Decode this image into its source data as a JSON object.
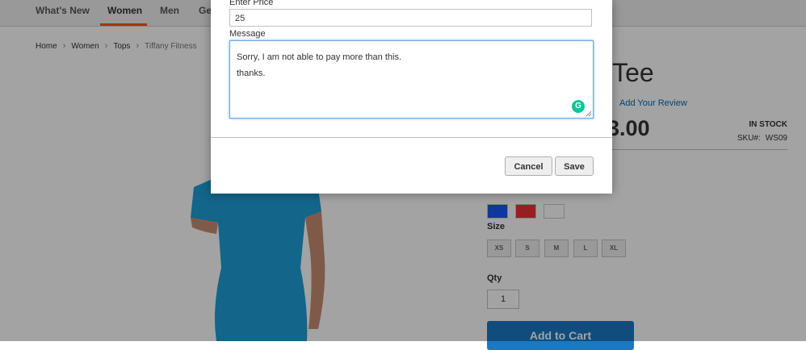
{
  "nav": {
    "items": [
      "What's New",
      "Women",
      "Men",
      "Ge"
    ],
    "active": "Women",
    "accent_color": "#ff5501"
  },
  "breadcrumb": [
    "Home",
    "Women",
    "Tops",
    "Tiffany Fitness"
  ],
  "product": {
    "title_visible": "ess Tee",
    "review_link": "Add Your Review",
    "price_visible": "3.00",
    "stock": "IN STOCK",
    "sku_label": "SKU#:",
    "sku_value": "WS09",
    "colors": [
      "#1857f7",
      "#ef3036",
      "#ffffff"
    ],
    "size_label": "Size",
    "sizes": [
      "XS",
      "S",
      "M",
      "L",
      "XL"
    ],
    "qty_label": "Qty",
    "qty_value": "1",
    "add_to_cart": "Add to Cart"
  },
  "modal": {
    "price_label": "Enter Price",
    "price_value": "25",
    "message_label": "Message",
    "message_lines": [
      "Sorry, I am not  able to pay more than this.",
      "thanks."
    ],
    "grammarly_icon": "G",
    "cancel_label": "Cancel",
    "save_label": "Save"
  }
}
